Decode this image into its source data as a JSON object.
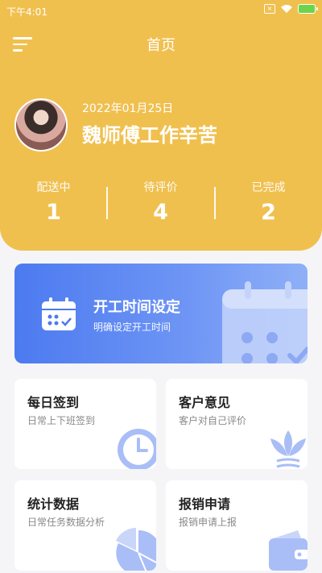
{
  "status": {
    "time": "下午4:01"
  },
  "header": {
    "title": "首页",
    "date": "2022年01月25日",
    "greeting": "魏师傅工作辛苦"
  },
  "stats": [
    {
      "label": "配送中",
      "value": "1"
    },
    {
      "label": "待评价",
      "value": "4"
    },
    {
      "label": "已完成",
      "value": "2"
    }
  ],
  "banner": {
    "title": "开工时间设定",
    "subtitle": "明确设定开工时间"
  },
  "cards": [
    {
      "title": "每日签到",
      "subtitle": "日常上下班签到",
      "icon": "clock-icon"
    },
    {
      "title": "客户意见",
      "subtitle": "客户对自己评价",
      "icon": "lotus-icon"
    },
    {
      "title": "统计数据",
      "subtitle": "日常任务数据分析",
      "icon": "pie-chart-icon"
    },
    {
      "title": "报销申请",
      "subtitle": "报销申请上报",
      "icon": "wallet-icon"
    }
  ],
  "colors": {
    "header": "#f0c04f",
    "accent": "#4c7af0",
    "deco": "#a9bdf7"
  }
}
